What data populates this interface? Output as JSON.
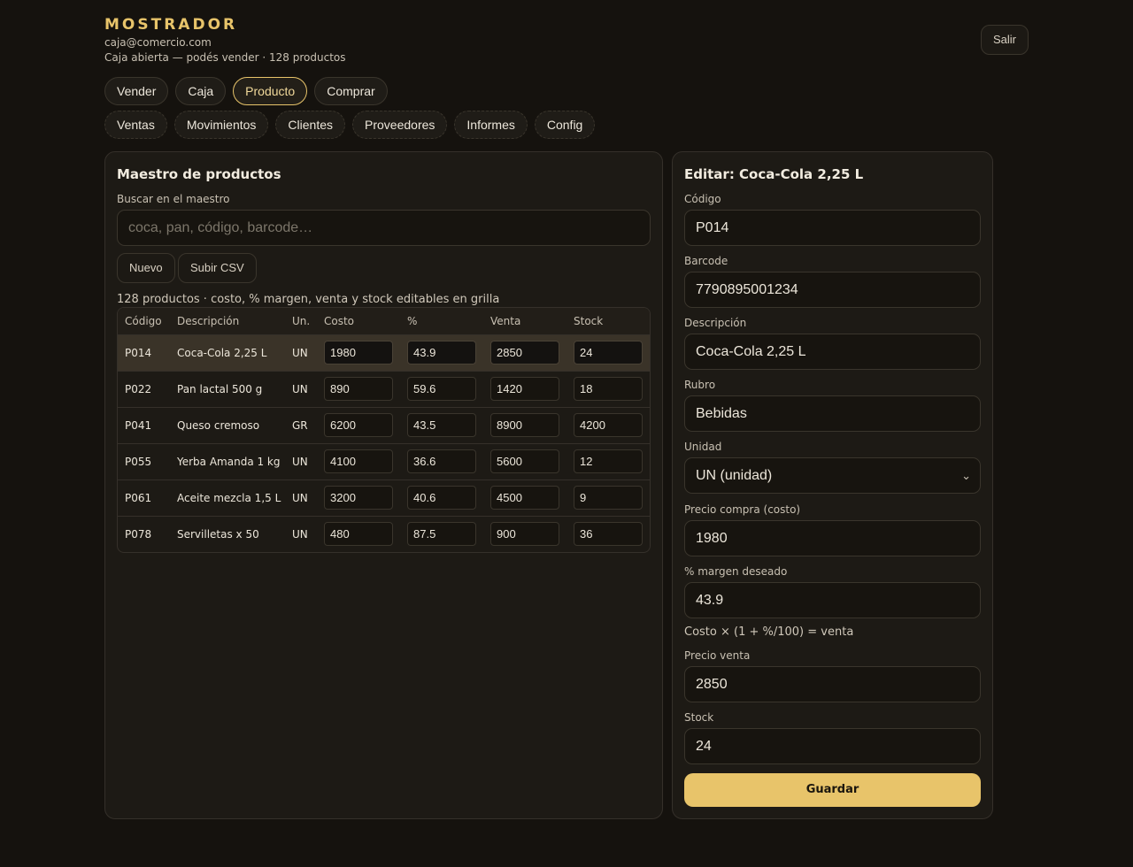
{
  "header": {
    "brand": "MOSTRADOR",
    "email": "caja@comercio.com",
    "status": "Caja abierta — podés vender · 128 productos",
    "logout_label": "Salir"
  },
  "nav": {
    "primary": [
      "Vender",
      "Caja",
      "Producto",
      "Comprar"
    ],
    "secondary": [
      "Ventas",
      "Movimientos",
      "Clientes",
      "Proveedores",
      "Informes",
      "Config"
    ],
    "active": "Producto"
  },
  "master": {
    "title": "Maestro de productos",
    "search_label": "Buscar en el maestro",
    "search_placeholder": "coca, pan, código, barcode…",
    "new_label": "Nuevo",
    "upload_label": "Subir CSV",
    "grid_note": "128 productos · costo, % margen, venta y stock editables en grilla",
    "columns": [
      "Código",
      "Descripción",
      "Un.",
      "Costo",
      "%",
      "Venta",
      "Stock"
    ],
    "rows": [
      {
        "code": "P014",
        "desc": "Coca-Cola 2,25 L",
        "unit": "UN",
        "cost": "1980",
        "pct": "43.9",
        "price": "2850",
        "stock": "24",
        "selected": true
      },
      {
        "code": "P022",
        "desc": "Pan lactal 500 g",
        "unit": "UN",
        "cost": "890",
        "pct": "59.6",
        "price": "1420",
        "stock": "18"
      },
      {
        "code": "P041",
        "desc": "Queso cremoso",
        "unit": "GR",
        "cost": "6200",
        "pct": "43.5",
        "price": "8900",
        "stock": "4200"
      },
      {
        "code": "P055",
        "desc": "Yerba Amanda 1 kg",
        "unit": "UN",
        "cost": "4100",
        "pct": "36.6",
        "price": "5600",
        "stock": "12"
      },
      {
        "code": "P061",
        "desc": "Aceite mezcla 1,5 L",
        "unit": "UN",
        "cost": "3200",
        "pct": "40.6",
        "price": "4500",
        "stock": "9"
      },
      {
        "code": "P078",
        "desc": "Servilletas x 50",
        "unit": "UN",
        "cost": "480",
        "pct": "87.5",
        "price": "900",
        "stock": "36"
      }
    ]
  },
  "editor": {
    "title": "Editar: Coca-Cola 2,25 L",
    "code_label": "Código",
    "code": "P014",
    "barcode_label": "Barcode",
    "barcode": "7790895001234",
    "desc_label": "Descripción",
    "desc": "Coca-Cola 2,25 L",
    "category_label": "Rubro",
    "category": "Bebidas",
    "unit_label": "Unidad",
    "unit": "UN (unidad)",
    "cost_label": "Precio compra (costo)",
    "cost": "1980",
    "margin_label": "% margen deseado",
    "margin": "43.9",
    "formula": "Costo × (1 + %/100) = venta",
    "price_label": "Precio venta",
    "price": "2850",
    "stock_label": "Stock",
    "stock": "24",
    "save_label": "Guardar"
  },
  "colors": {
    "accent": "#e8c46a",
    "background": "#15120e",
    "panel": "#1d1a15"
  }
}
